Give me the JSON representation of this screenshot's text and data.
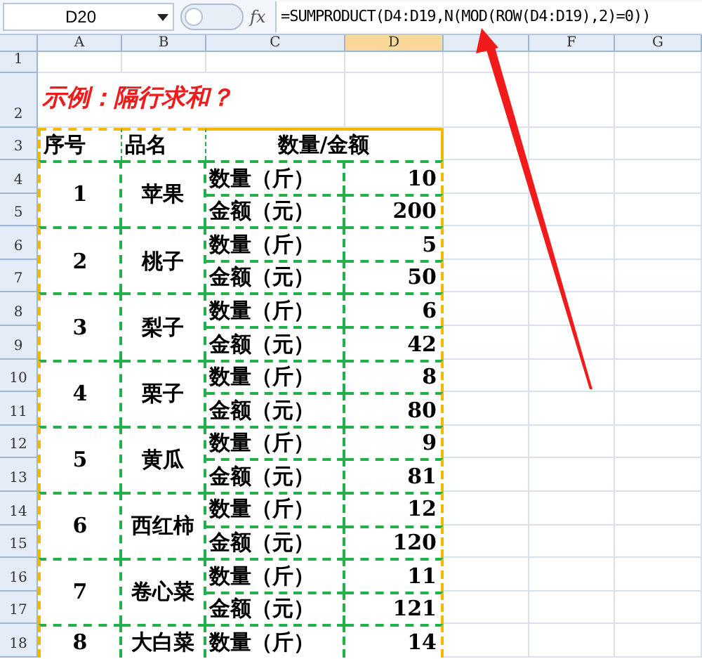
{
  "name_box": "D20",
  "formula_icon": "fx",
  "formula": "=SUMPRODUCT(D4:D19,N(MOD(ROW(D4:D19),2)=0))",
  "columns": [
    {
      "label": "A",
      "selected": false
    },
    {
      "label": "B",
      "selected": false
    },
    {
      "label": "C",
      "selected": false
    },
    {
      "label": "D",
      "selected": true
    },
    {
      "selected": false
    },
    {
      "label": "F",
      "selected": false
    },
    {
      "label": "G",
      "selected": false
    }
  ],
  "rows": [
    "1",
    "2",
    "3",
    "4",
    "5",
    "6",
    "7",
    "8",
    "9",
    "10",
    "11",
    "12",
    "13",
    "14",
    "15",
    "16",
    "17",
    "18"
  ],
  "title": "示例：隔行求和？",
  "table": {
    "headers": [
      "序号",
      "品名",
      "数量/金额"
    ],
    "groups": [
      {
        "index": "1",
        "item": "苹果",
        "lines": [
          {
            "label": "数量（斤）",
            "value": "10"
          },
          {
            "label": "金额（元）",
            "value": "200"
          }
        ]
      },
      {
        "index": "2",
        "item": "桃子",
        "lines": [
          {
            "label": "数量（斤）",
            "value": "5"
          },
          {
            "label": "金额（元）",
            "value": "50"
          }
        ]
      },
      {
        "index": "3",
        "item": "梨子",
        "lines": [
          {
            "label": "数量（斤）",
            "value": "6"
          },
          {
            "label": "金额（元）",
            "value": "42"
          }
        ]
      },
      {
        "index": "4",
        "item": "栗子",
        "lines": [
          {
            "label": "数量（斤）",
            "value": "8"
          },
          {
            "label": "金额（元）",
            "value": "80"
          }
        ]
      },
      {
        "index": "5",
        "item": "黄瓜",
        "lines": [
          {
            "label": "数量（斤）",
            "value": "9"
          },
          {
            "label": "金额（元）",
            "value": "81"
          }
        ]
      },
      {
        "index": "6",
        "item": "西红柿",
        "lines": [
          {
            "label": "数量（斤）",
            "value": "12"
          },
          {
            "label": "金额（元）",
            "value": "120"
          }
        ]
      },
      {
        "index": "7",
        "item": "卷心菜",
        "lines": [
          {
            "label": "数量（斤）",
            "value": "11"
          },
          {
            "label": "金额（元）",
            "value": "121"
          }
        ]
      },
      {
        "index": "8",
        "item": "大白菜",
        "lines": [
          {
            "label": "数量（斤）",
            "value": "14"
          }
        ]
      }
    ]
  }
}
